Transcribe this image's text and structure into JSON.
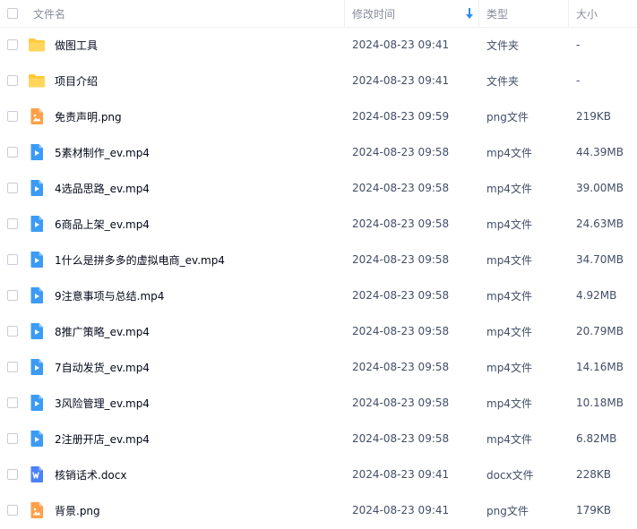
{
  "header": {
    "name_label": "文件名",
    "time_label": "修改时间",
    "type_label": "类型",
    "size_label": "大小"
  },
  "colors": {
    "folder": "#ffc937",
    "video": "#3c9bf4",
    "image": "#ff9f47",
    "doc": "#4a82f7",
    "sort_arrow": "#2b8cf7"
  },
  "rows": [
    {
      "name": "做图工具",
      "time": "2024-08-23 09:41",
      "type": "文件夹",
      "size": "-",
      "icon": "folder-icon"
    },
    {
      "name": "项目介绍",
      "time": "2024-08-23 09:41",
      "type": "文件夹",
      "size": "-",
      "icon": "folder-icon"
    },
    {
      "name": "免责声明.png",
      "time": "2024-08-23 09:59",
      "type": "png文件",
      "size": "219KB",
      "icon": "image-file-icon"
    },
    {
      "name": "5素材制作_ev.mp4",
      "time": "2024-08-23 09:58",
      "type": "mp4文件",
      "size": "44.39MB",
      "icon": "video-file-icon"
    },
    {
      "name": "4选品思路_ev.mp4",
      "time": "2024-08-23 09:58",
      "type": "mp4文件",
      "size": "39.00MB",
      "icon": "video-file-icon"
    },
    {
      "name": "6商品上架_ev.mp4",
      "time": "2024-08-23 09:58",
      "type": "mp4文件",
      "size": "24.63MB",
      "icon": "video-file-icon"
    },
    {
      "name": "1什么是拼多多的虚拟电商_ev.mp4",
      "time": "2024-08-23 09:58",
      "type": "mp4文件",
      "size": "34.70MB",
      "icon": "video-file-icon"
    },
    {
      "name": "9注意事项与总结.mp4",
      "time": "2024-08-23 09:58",
      "type": "mp4文件",
      "size": "4.92MB",
      "icon": "video-file-icon"
    },
    {
      "name": "8推广策略_ev.mp4",
      "time": "2024-08-23 09:58",
      "type": "mp4文件",
      "size": "20.79MB",
      "icon": "video-file-icon"
    },
    {
      "name": "7自动发货_ev.mp4",
      "time": "2024-08-23 09:58",
      "type": "mp4文件",
      "size": "14.16MB",
      "icon": "video-file-icon"
    },
    {
      "name": "3风险管理_ev.mp4",
      "time": "2024-08-23 09:58",
      "type": "mp4文件",
      "size": "10.18MB",
      "icon": "video-file-icon"
    },
    {
      "name": "2注册开店_ev.mp4",
      "time": "2024-08-23 09:58",
      "type": "mp4文件",
      "size": "6.82MB",
      "icon": "video-file-icon"
    },
    {
      "name": "核销话术.docx",
      "time": "2024-08-23 09:41",
      "type": "docx文件",
      "size": "228KB",
      "icon": "word-file-icon"
    },
    {
      "name": "背景.png",
      "time": "2024-08-23 09:41",
      "type": "png文件",
      "size": "179KB",
      "icon": "image-file-icon"
    }
  ]
}
